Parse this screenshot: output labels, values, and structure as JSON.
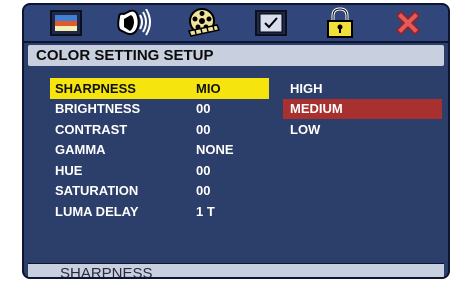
{
  "title": "COLOR SETTING SETUP",
  "menu_items": [
    {
      "label": "SHARPNESS",
      "value": "MIO"
    },
    {
      "label": "BRIGHTNESS",
      "value": "00"
    },
    {
      "label": "CONTRAST",
      "value": "00"
    },
    {
      "label": "GAMMA",
      "value": "NONE"
    },
    {
      "label": "HUE",
      "value": "00"
    },
    {
      "label": "SATURATION",
      "value": "00"
    },
    {
      "label": "LUMA DELAY",
      "value": "1 T"
    }
  ],
  "selected_menu_item": "SHARPNESS",
  "options": [
    "HIGH",
    "MEDIUM",
    "LOW"
  ],
  "selected_option": "MEDIUM",
  "status": "SHARPNESS",
  "tabs": [
    "picture-tab",
    "audio-tab",
    "video-tab",
    "preference-tab",
    "lock-tab",
    "exit-tab"
  ],
  "colors": {
    "panel": "#2c3e6a",
    "header_bar": "#c8cfde",
    "menu_highlight": "#f5e40d",
    "option_highlight": "#a8302e",
    "text": "#ffffff"
  }
}
